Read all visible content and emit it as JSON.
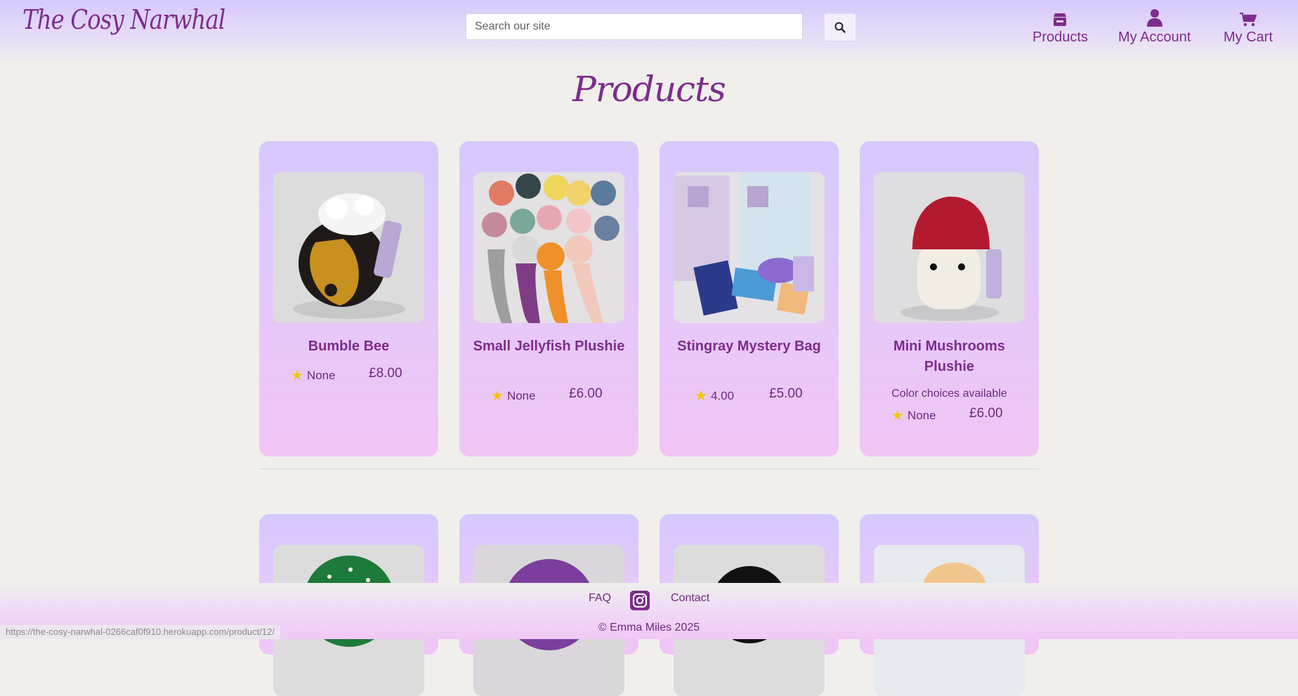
{
  "header": {
    "logo": "The Cosy Narwhal",
    "search_placeholder": "Search our site",
    "nav": [
      {
        "label": "Products",
        "icon": "store-icon"
      },
      {
        "label": "My Account",
        "icon": "user-icon"
      },
      {
        "label": "My Cart",
        "icon": "cart-icon"
      }
    ]
  },
  "main": {
    "title": "Products",
    "products": [
      {
        "name": "Bumble Bee",
        "rating": "None",
        "price": "£8.00",
        "note": ""
      },
      {
        "name": "Small Jellyfish Plushie",
        "rating": "None",
        "price": "£6.00",
        "note": ""
      },
      {
        "name": "Stingray Mystery Bag",
        "rating": "4.00",
        "price": "£5.00",
        "note": ""
      },
      {
        "name": "Mini Mushrooms Plushie",
        "rating": "None",
        "price": "£6.00",
        "note": "Color choices available"
      }
    ]
  },
  "footer": {
    "faq": "FAQ",
    "contact": "Contact",
    "copyright": "© Emma Miles 2025"
  },
  "status_bar": "https://the-cosy-narwhal-0266caf0f910.herokuapp.com/product/12/"
}
